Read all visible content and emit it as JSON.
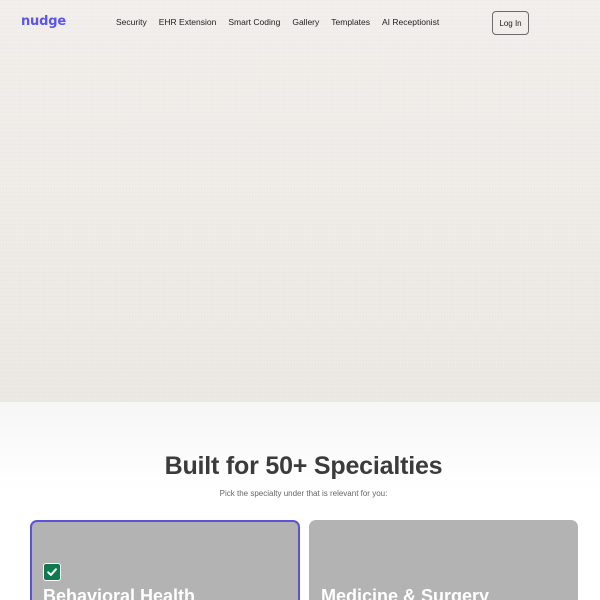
{
  "header": {
    "logo": "nudge",
    "nav_items": [
      {
        "label": "Security"
      },
      {
        "label": "EHR Extension"
      },
      {
        "label": "Smart Coding"
      },
      {
        "label": "Gallery"
      },
      {
        "label": "Templates"
      },
      {
        "label": "AI Receptionist"
      }
    ],
    "login_label": "Log In"
  },
  "specialties": {
    "title": "Built for 50+ Specialties",
    "subtitle": "Pick the specialty under that is relevant for you:",
    "cards": [
      {
        "label": "Behavioral Health",
        "selected": true
      },
      {
        "label": "Medicine & Surgery",
        "selected": false
      }
    ]
  },
  "colors": {
    "brand": "#5b56e6",
    "card_bg": "#b3b3b3",
    "check_green": "#0f7a4d",
    "selected_border": "#5b53d6"
  },
  "icons": {
    "check": "checkmark-icon"
  }
}
